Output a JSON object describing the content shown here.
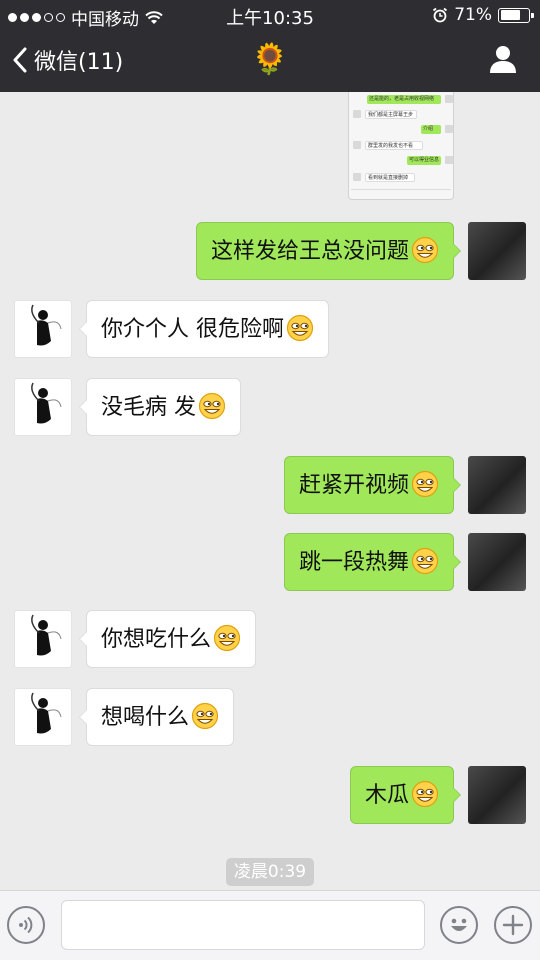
{
  "status_bar": {
    "carrier": "中国移动",
    "time": "上午10:35",
    "battery": "71%",
    "battery_level": 0.71,
    "signal_bars_filled": 3,
    "signal_bars_total": 5
  },
  "nav": {
    "back_label": "微信(11)",
    "title": "🌻"
  },
  "forwarded_screenshot": {
    "lines": [
      "还是能的，老是占用收视网络",
      "我们都是主屏幕王步",
      "介绍",
      "群里发的我发也不看",
      "可以得业信息",
      "看到就是直接删掉"
    ]
  },
  "messages": [
    {
      "side": "right",
      "text": "这样发给王总没问题"
    },
    {
      "side": "left",
      "text": "你介个人 很危险啊"
    },
    {
      "side": "left",
      "text": "没毛病 发"
    },
    {
      "side": "right",
      "text": "赶紧开视频"
    },
    {
      "side": "right",
      "text": "跳一段热舞"
    },
    {
      "side": "left",
      "text": "你想吃什么"
    },
    {
      "side": "left",
      "text": "想喝什么"
    },
    {
      "side": "right",
      "text": "木瓜"
    }
  ],
  "timestamp": "凌晨0:39",
  "colors": {
    "header": "#2e2e32",
    "self_bubble": "#a0e75a",
    "other_bubble": "#ffffff",
    "chat_bg": "#ebebeb"
  },
  "icons": {
    "emoji_in_messages": "grinning-smirk-emoji",
    "back": "chevron-left-icon",
    "profile": "person-icon",
    "voice": "voice-icon",
    "emoji_button": "smiley-icon",
    "more": "plus-icon"
  }
}
